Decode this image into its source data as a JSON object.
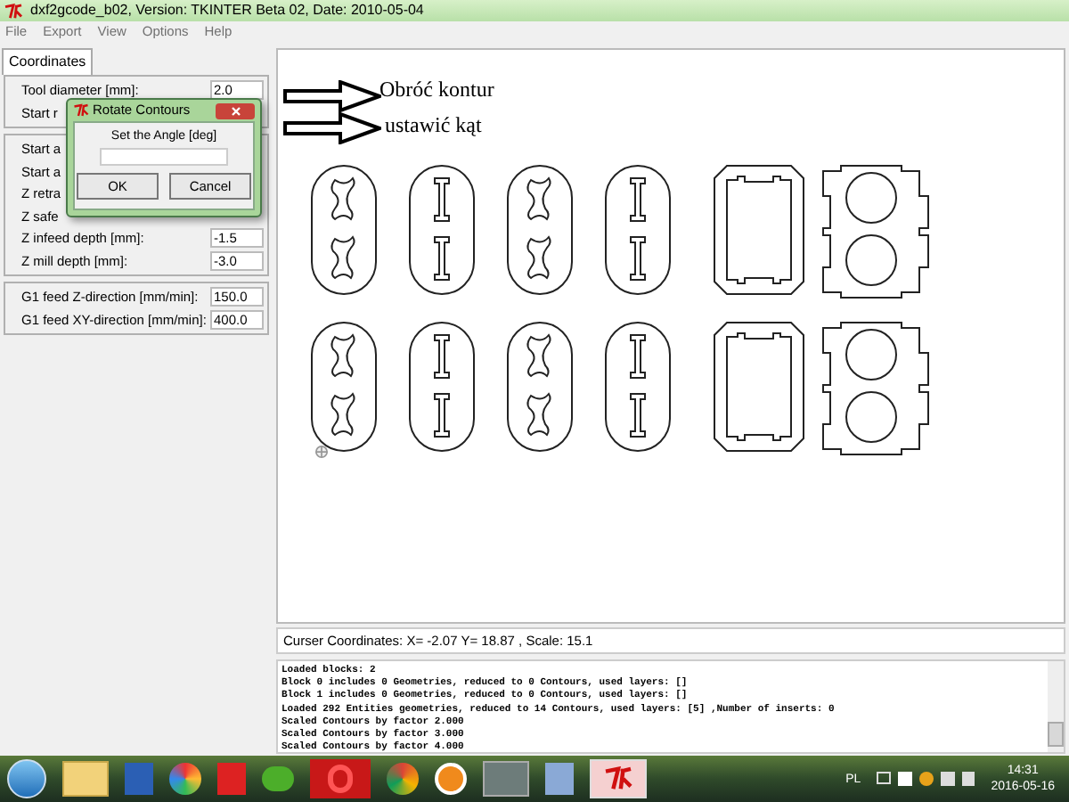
{
  "window": {
    "title": "dxf2gcode_b02, Version: TKINTER Beta 02, Date: 2010-05-04"
  },
  "menu": [
    "File",
    "Export",
    "View",
    "Options",
    "Help"
  ],
  "tabs": [
    {
      "label": "Coordinates",
      "selected": true
    }
  ],
  "field_groups": [
    [
      {
        "label": "Tool diameter [mm]:",
        "value": "2.0"
      },
      {
        "label": "Start r"
      }
    ],
    [
      {
        "label": "Start a"
      },
      {
        "label": "Start a"
      },
      {
        "label": "Z retra"
      },
      {
        "label": "Z safe"
      },
      {
        "label": "Z infeed depth [mm]:",
        "value": "-1.5"
      },
      {
        "label": "Z mill depth [mm]:",
        "value": "-3.0"
      }
    ],
    [
      {
        "label": "G1 feed Z-direction [mm/min]:",
        "value": "150.0"
      },
      {
        "label": "G1 feed XY-direction [mm/min]:",
        "value": "400.0"
      }
    ]
  ],
  "dialog": {
    "title": "Rotate Contours",
    "prompt": "Set the Angle [deg]",
    "buttons": [
      "OK",
      "Cancel"
    ]
  },
  "annotations": [
    "Obróć kontur",
    "ustawić kąt"
  ],
  "status": "Curser Coordinates: X= -2.07 Y= 18.87 , Scale: 15.1",
  "log": [
    "Loaded blocks: 2",
    "Block 0 includes 0 Geometries, reduced to 0 Contours, used layers: []",
    "Block 1 includes 0 Geometries, reduced to 0 Contours, used layers: []",
    "Loaded 292 Entities geometries, reduced to 14 Contours, used layers: [5] ,Number of inserts: 0",
    "Scaled Contours by factor 2.000",
    "Scaled Contours by factor 3.000",
    "Scaled Contours by factor 4.000"
  ],
  "taskbar": {
    "language": "PL",
    "time": "14:31",
    "date": "2016-05-16"
  }
}
